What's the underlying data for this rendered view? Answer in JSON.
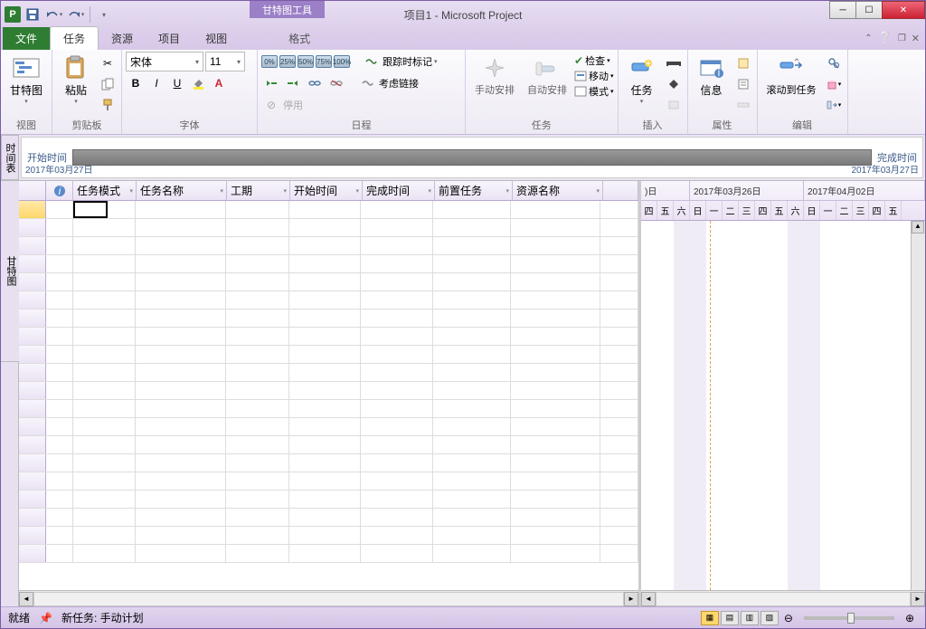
{
  "title": "项目1 - Microsoft Project",
  "context_tab": "甘特图工具",
  "tabs": {
    "file": "文件",
    "task": "任务",
    "resource": "资源",
    "project": "项目",
    "view": "视图",
    "format": "格式"
  },
  "ribbon": {
    "view_group": "视图",
    "gantt": "甘特图",
    "clipboard": "剪贴板",
    "paste": "粘贴",
    "font_group": "字体",
    "font_name": "宋体",
    "font_size": "11",
    "schedule_group": "日程",
    "respect_links": "跟踪时标记",
    "inactivate": "考虑链接",
    "split": "停用",
    "tasks_group": "任务",
    "manual": "手动安排",
    "auto": "自动安排",
    "inspect": "检查",
    "move": "移动",
    "mode": "模式",
    "insert_group": "插入",
    "task_btn": "任务",
    "properties_group": "属性",
    "information": "信息",
    "editing_group": "编辑",
    "scroll_to": "滚动到任务",
    "pct": [
      "0%",
      "25%",
      "50%",
      "75%",
      "100%"
    ]
  },
  "timeline": {
    "start_label": "开始时间",
    "finish_label": "完成时间",
    "start_date": "2017年03月27日",
    "finish_date": "2017年03月27日",
    "side": "时间表"
  },
  "columns": [
    "任务模式",
    "任务名称",
    "工期",
    "开始时间",
    "完成时间",
    "前置任务",
    "资源名称"
  ],
  "gantt": {
    "week1": "2017年03月26日",
    "week2": "2017年04月02日",
    "days": [
      "四",
      "五",
      "六",
      "日",
      "一",
      "二",
      "三",
      "四",
      "五",
      "六",
      "日",
      "一",
      "二",
      "三",
      "四",
      "五"
    ]
  },
  "side_gantt": "甘特图",
  "status": {
    "ready": "就绪",
    "new_task": "新任务: 手动计划"
  }
}
